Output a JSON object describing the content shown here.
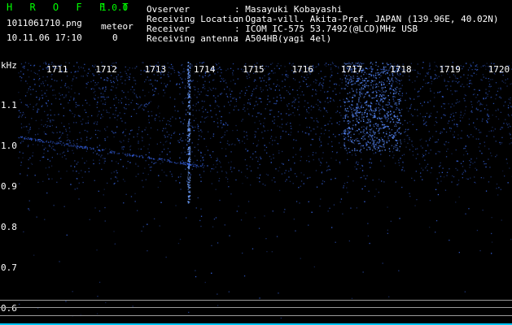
{
  "app": {
    "title": "H R O F F T",
    "version": "1.0.0",
    "filename": "1011061710.png",
    "datetime": "10.11.06 17:10",
    "meteor_label": "meteor",
    "meteor_count": "0"
  },
  "info": {
    "observer_label": "Ovserver",
    "observer_value": ": Masayuki Kobayashi",
    "location_label": "Receiving Location",
    "location_value": ": Ogata-vill. Akita-Pref. JAPAN (139.96E, 40.02N)",
    "receiver_label": "Receiver",
    "receiver_value": ": ICOM IC-575 53.7492(@LCD)MHz USB",
    "antenna_label": "Receiving antenna",
    "antenna_value": ": A504HB(yagi 4el)"
  },
  "axes": {
    "y_unit": "kHz",
    "x_ticks": [
      "1711",
      "1712",
      "1713",
      "1714",
      "1715",
      "1716",
      "1717",
      "1718",
      "1719",
      "1720"
    ],
    "y_ticks": [
      "1.1",
      "1.0",
      "0.9",
      "0.8",
      "0.7",
      "0.6"
    ]
  },
  "colors": {
    "background": "#000000",
    "title_green": "#00ff00",
    "signal_blue": "#2a5aff",
    "bottom_bar": "#00c8ff"
  }
}
